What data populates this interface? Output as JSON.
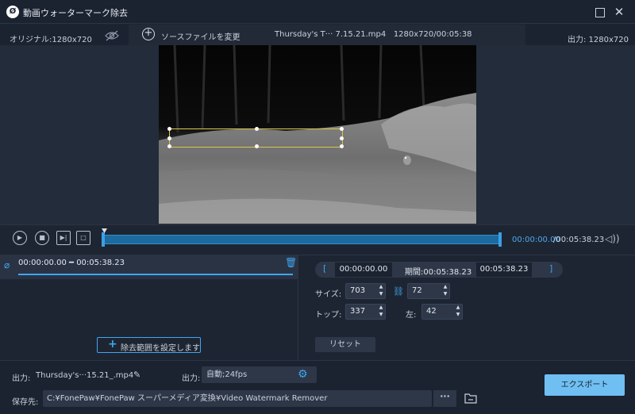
{
  "window": {
    "title": "動画ウォーターマーク除去",
    "logo_glyph": "Ø"
  },
  "infobar": {
    "original": "オリジナル:1280x720",
    "change_source": "ソースファイルを変更",
    "file_name": "Thursday's T··· 7.15.21.mp4",
    "file_meta": "1280x720/00:05:38",
    "output": "出力: 1280x720"
  },
  "playback": {
    "current_time": "00:00:00.00",
    "total_time": "/00:05:38.23"
  },
  "segment": {
    "range": "00:00:00.00 ━ 00:05:38.23",
    "add_range_label": "除去範囲を設定します"
  },
  "range_editor": {
    "start": "00:00:00.00",
    "duration": "期間:00:05:38.23",
    "end": "00:05:38.23"
  },
  "watermark": {
    "size_label": "サイズ:",
    "width": "703",
    "height": "72",
    "top_label": "トップ:",
    "top": "337",
    "left_label": "左:",
    "left": "42",
    "reset_label": "リセット"
  },
  "output": {
    "label": "出力:",
    "file": "Thursday's···15.21_.mp4",
    "format_label": "出力:",
    "format": "自動;24fps",
    "save_label": "保存先:",
    "save_path": "C:¥FonePaw¥FonePaw スーパーメディア変換¥Video Watermark Remover",
    "browse": "···",
    "export": "エクスポート"
  },
  "colors": {
    "accent": "#3fa6ef",
    "export_button": "#6fbff2",
    "watermark_box": "#d6c84a"
  }
}
